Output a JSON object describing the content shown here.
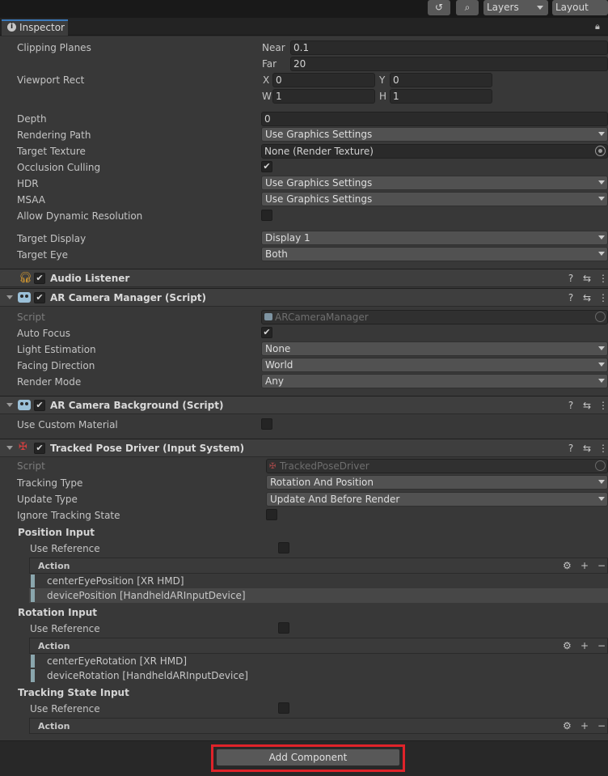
{
  "toolbar": {
    "layers_label": "Layers",
    "layout_label": "Layout"
  },
  "tab": {
    "label": "Inspector"
  },
  "camera": {
    "clipping_planes": "Clipping Planes",
    "near_label": "Near",
    "near_value": "0.1",
    "far_label": "Far",
    "far_value": "20",
    "viewport_rect": "Viewport Rect",
    "x_label": "X",
    "x_value": "0",
    "y_label": "Y",
    "y_value": "0",
    "w_label": "W",
    "w_value": "1",
    "h_label": "H",
    "h_value": "1",
    "depth": "Depth",
    "depth_value": "0",
    "rendering_path": "Rendering Path",
    "rendering_path_value": "Use Graphics Settings",
    "target_texture": "Target Texture",
    "target_texture_value": "None (Render Texture)",
    "occlusion_culling": "Occlusion Culling",
    "hdr": "HDR",
    "hdr_value": "Use Graphics Settings",
    "msaa": "MSAA",
    "msaa_value": "Use Graphics Settings",
    "allow_dynamic_resolution": "Allow Dynamic Resolution",
    "target_display": "Target Display",
    "target_display_value": "Display 1",
    "target_eye": "Target Eye",
    "target_eye_value": "Both"
  },
  "audio_listener": {
    "title": "Audio Listener"
  },
  "ar_camera_manager": {
    "title": "AR Camera Manager (Script)",
    "script": "Script",
    "script_value": "ARCameraManager",
    "auto_focus": "Auto Focus",
    "light_estimation": "Light Estimation",
    "light_estimation_value": "None",
    "facing_direction": "Facing Direction",
    "facing_direction_value": "World",
    "render_mode": "Render Mode",
    "render_mode_value": "Any"
  },
  "ar_camera_background": {
    "title": "AR Camera Background (Script)",
    "use_custom_material": "Use Custom Material"
  },
  "tracked_pose_driver": {
    "title": "Tracked Pose Driver (Input System)",
    "script": "Script",
    "script_value": "TrackedPoseDriver",
    "tracking_type": "Tracking Type",
    "tracking_type_value": "Rotation And Position",
    "update_type": "Update Type",
    "update_type_value": "Update And Before Render",
    "ignore_tracking_state": "Ignore Tracking State",
    "position_input": "Position Input",
    "rotation_input": "Rotation Input",
    "tracking_state_input": "Tracking State Input",
    "use_reference": "Use Reference",
    "action": "Action",
    "position_actions": [
      "centerEyePosition [XR HMD]",
      "devicePosition [HandheldARInputDevice]"
    ],
    "rotation_actions": [
      "centerEyeRotation [XR HMD]",
      "deviceRotation [HandheldARInputDevice]"
    ]
  },
  "add_component": {
    "label": "Add Component"
  },
  "colors": {
    "highlight_border": "#e0232a",
    "tab_accent": "#3a79bb"
  }
}
